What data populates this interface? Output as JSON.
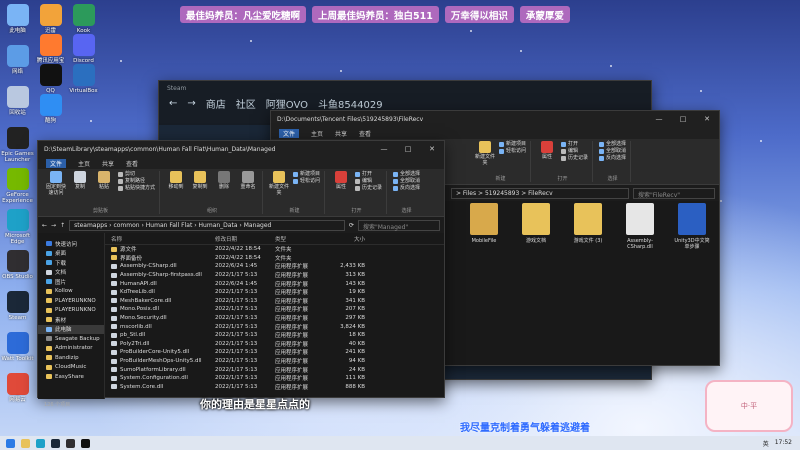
{
  "banner": {
    "items": [
      "最佳妈养员：凡尘爱吃糖啊",
      "上周最佳妈养员：独白511",
      "万幸得以相识",
      "承蒙厚爱"
    ]
  },
  "desktop_icons": [
    {
      "label": "此电脑",
      "icon": "computer-icon",
      "color": "#7ab4f5"
    },
    {
      "label": "网络",
      "icon": "network-icon",
      "color": "#5c9ce6"
    },
    {
      "label": "回收站",
      "icon": "recycle-bin-icon",
      "color": "#b9c8e0"
    },
    {
      "label": "Epic Games Launcher",
      "icon": "epic-icon",
      "color": "#222222"
    },
    {
      "label": "GeForce Experience",
      "icon": "geforce-icon",
      "color": "#76b900"
    },
    {
      "label": "Microsoft Edge",
      "icon": "edge-icon",
      "color": "#1ea1c8"
    },
    {
      "label": "OBS Studio",
      "icon": "obs-icon",
      "color": "#302e31"
    },
    {
      "label": "Steam",
      "icon": "steam-icon",
      "color": "#1b2838"
    },
    {
      "label": "Watt Toolkit",
      "icon": "shield-app-icon",
      "color": "#2d6bd8"
    },
    {
      "label": "网易云",
      "icon": "music-app-icon",
      "color": "#e04a3a"
    }
  ],
  "desktop_icons_col2": [
    {
      "label": "迅雷",
      "icon": "thunder-icon",
      "color": "#f2a33a"
    },
    {
      "label": "腾讯应用宝",
      "icon": "app-store-icon",
      "color": "#ff7a2f"
    },
    {
      "label": "QQ",
      "icon": "qq-icon",
      "color": "#111111"
    },
    {
      "label": "酷狗",
      "icon": "music-icon",
      "color": "#2f8ef3"
    }
  ],
  "desktop_icons_col3": [
    {
      "label": "Kook",
      "icon": "k-app-icon",
      "color": "#2c9a5b"
    },
    {
      "label": "Discord",
      "icon": "discord-icon",
      "color": "#5865f2"
    },
    {
      "label": "VirtualBox",
      "icon": "vm-icon",
      "color": "#2b6fbf"
    }
  ],
  "steam_window": {
    "title": "Steam",
    "nav": [
      "商店",
      "社区",
      "阿狸OVO",
      "斗鱼8544029"
    ]
  },
  "explorer_back": {
    "path": "D:\\Documents\\Tencent Files\\519245893\\FileRecv",
    "tabs": [
      "文件",
      "主页",
      "共享",
      "查看"
    ],
    "breadcrumb": "> Files > 519245893 > FileRecv",
    "search_placeholder": "搜索\"FileRecv\"",
    "ribbon": {
      "new_item": "新建项目",
      "easy_access": "轻松访问",
      "new_folder": "新建文件夹",
      "properties": "属性",
      "open": "打开",
      "edit": "编辑",
      "history": "历史记录",
      "select_all": "全部选择",
      "select_none": "全部取消",
      "invert_select": "反向选择",
      "group_new": "新建",
      "group_open": "打开",
      "group_select": "选择"
    },
    "tiles": [
      {
        "label": "MobileFile",
        "color": "#d8a94b"
      },
      {
        "label": "游戏文档",
        "color": "#e8c25a"
      },
      {
        "label": "游戏文件 (3)",
        "color": "#e8c25a"
      },
      {
        "label": "Assembly-CSharp.dll",
        "color": "#e6e6e6"
      },
      {
        "label": "Unity3D中文简单步骤",
        "color": "#2b5fc2"
      }
    ]
  },
  "explorer_front": {
    "path": "D:\\SteamLibrary\\steamapps\\common\\Human Fall Flat\\Human_Data\\Managed",
    "tabs": [
      "文件",
      "主页",
      "共享",
      "查看"
    ],
    "ribbon": {
      "pin": "固定到快速访问",
      "copy": "复制",
      "paste": "粘贴",
      "cut": "剪切",
      "copy_path": "复制路径",
      "paste_shortcut": "粘贴快捷方式",
      "move_to": "移动到",
      "copy_to": "复制到",
      "delete": "删除",
      "rename": "重命名",
      "new_folder": "新建文件夹",
      "new_item": "新建项目",
      "easy_access": "轻松访问",
      "properties": "属性",
      "open": "打开",
      "edit": "编辑",
      "history": "历史记录",
      "select_all": "全部选择",
      "select_none": "全部取消",
      "invert_select": "反向选择",
      "group_clipboard": "剪贴板",
      "group_organize": "组织",
      "group_new": "新建",
      "group_open": "打开",
      "group_select": "选择"
    },
    "breadcrumb": [
      "steamapps",
      "common",
      "Human Fall Flat",
      "Human_Data",
      "Managed"
    ],
    "search_placeholder": "搜索\"Managed\"",
    "nav": [
      {
        "label": "快速访问",
        "color": "#3b7be0",
        "sel": false
      },
      {
        "label": "桌面",
        "color": "#4aa3e6",
        "sel": false
      },
      {
        "label": "下载",
        "color": "#4aa3e6",
        "sel": false
      },
      {
        "label": "文档",
        "color": "#cfd6df",
        "sel": false
      },
      {
        "label": "图片",
        "color": "#4aa3e6",
        "sel": false
      },
      {
        "label": "Kollow",
        "color": "#e8c25a",
        "sel": false
      },
      {
        "label": "PLAYERUNKNO",
        "color": "#e8c25a",
        "sel": false
      },
      {
        "label": "PLAYERUNKNO",
        "color": "#e8c25a",
        "sel": false
      },
      {
        "label": "素材",
        "color": "#e8c25a",
        "sel": false
      },
      {
        "label": "此电脑",
        "color": "#7ab4f5",
        "sel": true
      },
      {
        "label": "Seagate Backup",
        "color": "#888888",
        "sel": false
      },
      {
        "label": "Administrator",
        "color": "#e8c25a",
        "sel": false
      },
      {
        "label": "Bandizip",
        "color": "#e8c25a",
        "sel": false
      },
      {
        "label": "CloudMusic",
        "color": "#e8c25a",
        "sel": false
      },
      {
        "label": "EasyShare",
        "color": "#e8c25a",
        "sel": false
      }
    ],
    "columns": [
      "名称",
      "修改日期",
      "类型",
      "大小"
    ],
    "files": [
      {
        "name": "源文件",
        "date": "2022/4/22 18:54",
        "type": "文件夹",
        "size": "",
        "color": "#e8c25a"
      },
      {
        "name": "界面备份",
        "date": "2022/4/22 18:54",
        "type": "文件夹",
        "size": "",
        "color": "#e8c25a"
      },
      {
        "name": "Assembly-CSharp.dll",
        "date": "2022/6/24 1:45",
        "type": "应用程序扩展",
        "size": "2,433 KB",
        "color": "#cfd6df"
      },
      {
        "name": "Assembly-CSharp-firstpass.dll",
        "date": "2022/1/17 5:13",
        "type": "应用程序扩展",
        "size": "313 KB",
        "color": "#cfd6df"
      },
      {
        "name": "HumanAPI.dll",
        "date": "2022/6/24 1:45",
        "type": "应用程序扩展",
        "size": "143 KB",
        "color": "#cfd6df"
      },
      {
        "name": "KdTreeLib.dll",
        "date": "2022/1/17 5:13",
        "type": "应用程序扩展",
        "size": "19 KB",
        "color": "#cfd6df"
      },
      {
        "name": "MeshBakerCore.dll",
        "date": "2022/1/17 5:13",
        "type": "应用程序扩展",
        "size": "341 KB",
        "color": "#cfd6df"
      },
      {
        "name": "Mono.Posix.dll",
        "date": "2022/1/17 5:13",
        "type": "应用程序扩展",
        "size": "207 KB",
        "color": "#cfd6df"
      },
      {
        "name": "Mono.Security.dll",
        "date": "2022/1/17 5:13",
        "type": "应用程序扩展",
        "size": "297 KB",
        "color": "#cfd6df"
      },
      {
        "name": "mscorlib.dll",
        "date": "2022/1/17 5:13",
        "type": "应用程序扩展",
        "size": "3,824 KB",
        "color": "#cfd6df"
      },
      {
        "name": "pb_Stl.dll",
        "date": "2022/1/17 5:13",
        "type": "应用程序扩展",
        "size": "18 KB",
        "color": "#cfd6df"
      },
      {
        "name": "Poly2Tri.dll",
        "date": "2022/1/17 5:13",
        "type": "应用程序扩展",
        "size": "40 KB",
        "color": "#cfd6df"
      },
      {
        "name": "ProBuilderCore-Unity5.dll",
        "date": "2022/1/17 5:13",
        "type": "应用程序扩展",
        "size": "241 KB",
        "color": "#cfd6df"
      },
      {
        "name": "ProBuilderMeshOps-Unity5.dll",
        "date": "2022/1/17 5:13",
        "type": "应用程序扩展",
        "size": "94 KB",
        "color": "#cfd6df"
      },
      {
        "name": "SumoPlatformLibrary.dll",
        "date": "2022/1/17 5:13",
        "type": "应用程序扩展",
        "size": "24 KB",
        "color": "#cfd6df"
      },
      {
        "name": "System.Configuration.dll",
        "date": "2022/1/17 5:13",
        "type": "应用程序扩展",
        "size": "111 KB",
        "color": "#cfd6df"
      },
      {
        "name": "System.Core.dll",
        "date": "2022/1/17 5:13",
        "type": "应用程序扩展",
        "size": "888 KB",
        "color": "#cfd6df"
      }
    ],
    "status": "126 个项目"
  },
  "subtitles": {
    "line1": "你的理由是星星点点的",
    "line2": "我尽量克制着勇气躲着逃避着"
  },
  "mascot_text": "中·平",
  "taskbar": {
    "time": "17:52",
    "lang": "英"
  }
}
